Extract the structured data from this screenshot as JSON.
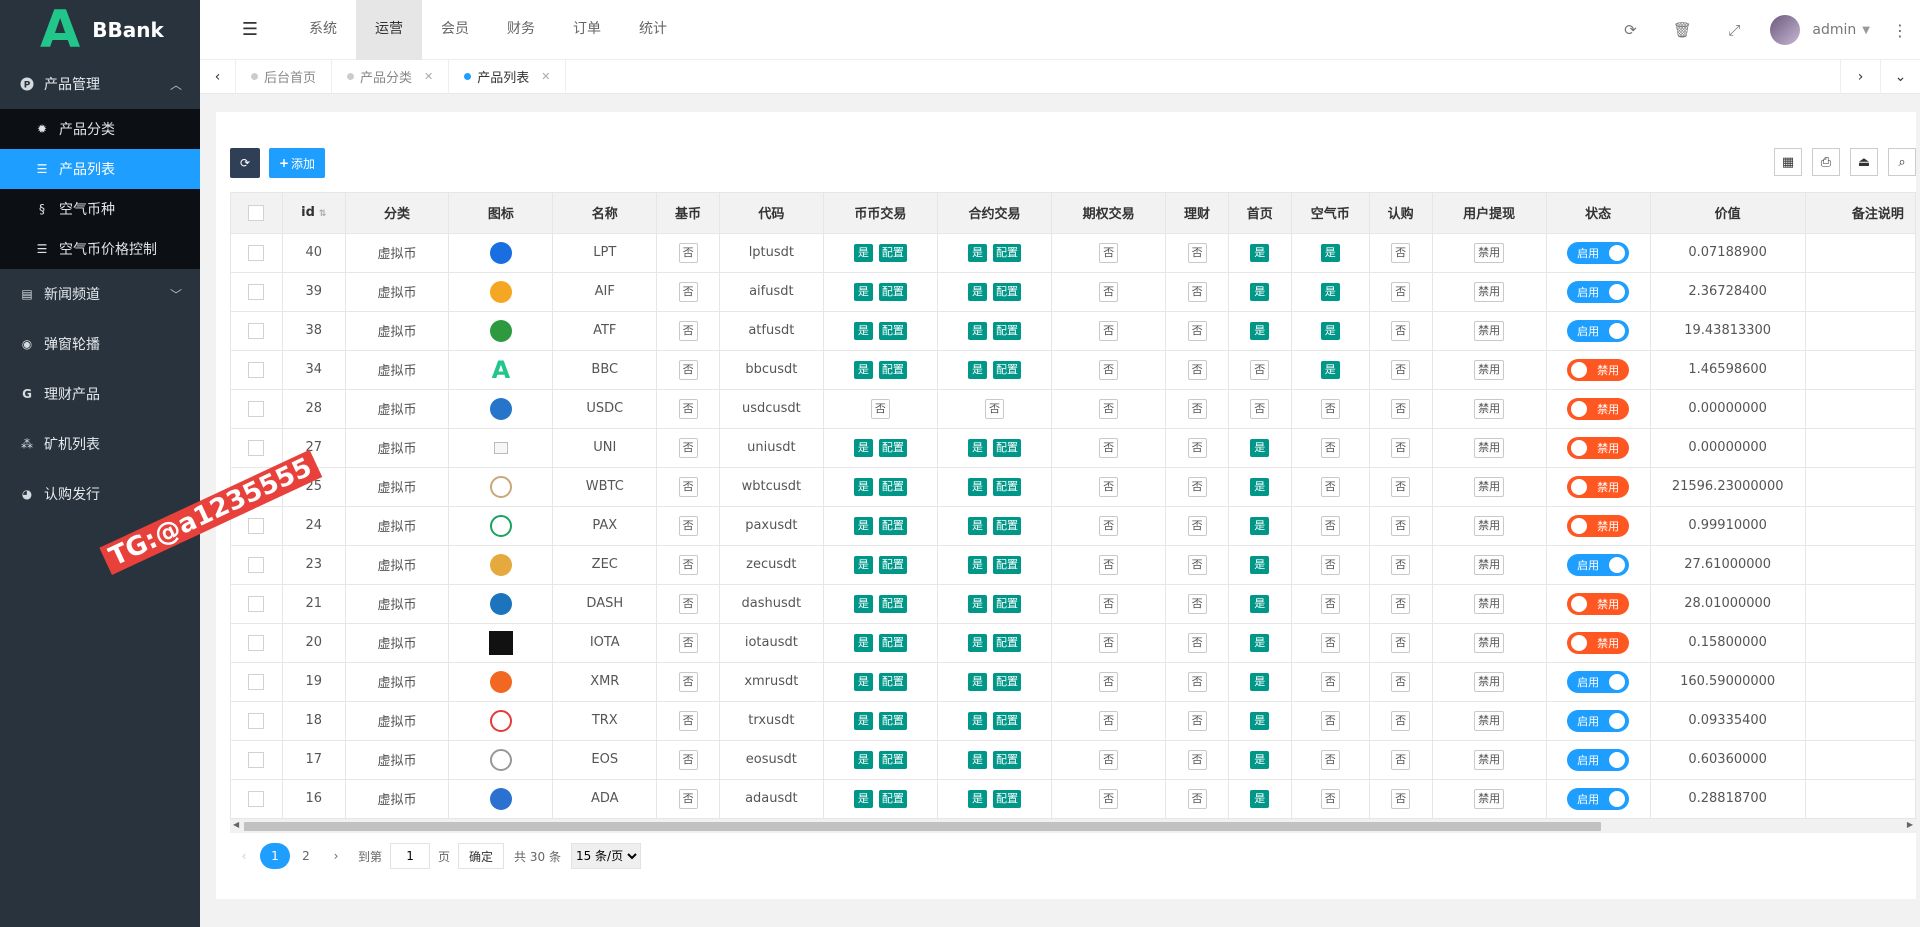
{
  "app": {
    "logo_letter": "A",
    "name": "BBank"
  },
  "sidebar": {
    "groups": [
      {
        "label": "产品管理",
        "icon": "p-circle-icon",
        "expanded": true,
        "items": [
          {
            "label": "产品分类",
            "icon": "gear-icon",
            "active": false
          },
          {
            "label": "产品列表",
            "icon": "list-icon",
            "active": true
          },
          {
            "label": "空气币种",
            "icon": "coin-icon",
            "active": false
          },
          {
            "label": "空气币价格控制",
            "icon": "list-icon",
            "active": false
          }
        ]
      },
      {
        "label": "新闻频道",
        "icon": "news-icon",
        "expanded": false
      },
      {
        "label": "弹窗轮播",
        "icon": "compass-icon"
      },
      {
        "label": "理财产品",
        "icon": "g-icon"
      },
      {
        "label": "矿机列表",
        "icon": "cubes-icon"
      },
      {
        "label": "认购发行",
        "icon": "pie-icon"
      }
    ]
  },
  "header": {
    "nav": [
      "系统",
      "运营",
      "会员",
      "财务",
      "订单",
      "统计"
    ],
    "active_nav": "运营",
    "user": "admin"
  },
  "tabs": [
    {
      "label": "后台首页",
      "closable": false,
      "active": false
    },
    {
      "label": "产品分类",
      "closable": true,
      "active": false
    },
    {
      "label": "产品列表",
      "closable": true,
      "active": true
    }
  ],
  "toolbar": {
    "add_label": "添加"
  },
  "table": {
    "columns": [
      "id",
      "分类",
      "图标",
      "名称",
      "基币",
      "代码",
      "币币交易",
      "合约交易",
      "期权交易",
      "理财",
      "首页",
      "空气币",
      "认购",
      "用户提现",
      "状态",
      "价值",
      "备注说明"
    ],
    "labels": {
      "yes": "是",
      "no": "否",
      "config": "配置",
      "disabled_btn": "禁用",
      "on": "启用",
      "off": "禁用"
    },
    "rows": [
      {
        "id": "40",
        "cat": "虚拟币",
        "icon": "lpt-icon",
        "color": "#1a6fe0",
        "name": "LPT",
        "base": "否",
        "code": "lptusdt",
        "spot": true,
        "contract": true,
        "option": false,
        "finance": false,
        "home": true,
        "air": true,
        "subscribe": false,
        "status": true,
        "value": "0.07188900"
      },
      {
        "id": "39",
        "cat": "虚拟币",
        "icon": "aif-icon",
        "color": "#f5a623",
        "name": "AIF",
        "base": "否",
        "code": "aifusdt",
        "spot": true,
        "contract": true,
        "option": false,
        "finance": false,
        "home": true,
        "air": true,
        "subscribe": false,
        "status": true,
        "value": "2.36728400"
      },
      {
        "id": "38",
        "cat": "虚拟币",
        "icon": "atf-icon",
        "color": "#2e9a3f",
        "name": "ATF",
        "base": "否",
        "code": "atfusdt",
        "spot": true,
        "contract": true,
        "option": false,
        "finance": false,
        "home": true,
        "air": true,
        "subscribe": false,
        "status": true,
        "value": "19.43813300"
      },
      {
        "id": "34",
        "cat": "虚拟币",
        "icon": "bbc-icon",
        "color": "#22c58a",
        "name": "BBC",
        "base": "否",
        "code": "bbcusdt",
        "spot": true,
        "contract": true,
        "option": false,
        "finance": false,
        "home": false,
        "air": true,
        "subscribe": false,
        "status": false,
        "value": "1.46598600"
      },
      {
        "id": "28",
        "cat": "虚拟币",
        "icon": "usdc-icon",
        "color": "#2775ca",
        "name": "USDC",
        "base": "否",
        "code": "usdcusdt",
        "spot": false,
        "contract": false,
        "option": false,
        "finance": false,
        "home": false,
        "air": false,
        "subscribe": false,
        "status": false,
        "value": "0.00000000"
      },
      {
        "id": "27",
        "cat": "虚拟币",
        "icon": "broken-image-icon",
        "color": "#cccccc",
        "name": "UNI",
        "base": "否",
        "code": "uniusdt",
        "spot": true,
        "contract": true,
        "option": false,
        "finance": false,
        "home": true,
        "air": false,
        "subscribe": false,
        "status": false,
        "value": "0.00000000"
      },
      {
        "id": "25",
        "cat": "虚拟币",
        "icon": "wbtc-icon",
        "color": "#c9a87a",
        "name": "WBTC",
        "base": "否",
        "code": "wbtcusdt",
        "spot": true,
        "contract": true,
        "option": false,
        "finance": false,
        "home": true,
        "air": false,
        "subscribe": false,
        "status": false,
        "value": "21596.23000000"
      },
      {
        "id": "24",
        "cat": "虚拟币",
        "icon": "pax-icon",
        "color": "#1aa25e",
        "name": "PAX",
        "base": "否",
        "code": "paxusdt",
        "spot": true,
        "contract": true,
        "option": false,
        "finance": false,
        "home": true,
        "air": false,
        "subscribe": false,
        "status": false,
        "value": "0.99910000"
      },
      {
        "id": "23",
        "cat": "虚拟币",
        "icon": "zec-icon",
        "color": "#e5a93d",
        "name": "ZEC",
        "base": "否",
        "code": "zecusdt",
        "spot": true,
        "contract": true,
        "option": false,
        "finance": false,
        "home": true,
        "air": false,
        "subscribe": false,
        "status": true,
        "value": "27.61000000"
      },
      {
        "id": "21",
        "cat": "虚拟币",
        "icon": "dash-icon",
        "color": "#1c75bc",
        "name": "DASH",
        "base": "否",
        "code": "dashusdt",
        "spot": true,
        "contract": true,
        "option": false,
        "finance": false,
        "home": true,
        "air": false,
        "subscribe": false,
        "status": false,
        "value": "28.01000000"
      },
      {
        "id": "20",
        "cat": "虚拟币",
        "icon": "iota-icon",
        "color": "#111111",
        "name": "IOTA",
        "base": "否",
        "code": "iotausdt",
        "spot": true,
        "contract": true,
        "option": false,
        "finance": false,
        "home": true,
        "air": false,
        "subscribe": false,
        "status": false,
        "value": "0.15800000"
      },
      {
        "id": "19",
        "cat": "虚拟币",
        "icon": "xmr-icon",
        "color": "#f26822",
        "name": "XMR",
        "base": "否",
        "code": "xmrusdt",
        "spot": true,
        "contract": true,
        "option": false,
        "finance": false,
        "home": true,
        "air": false,
        "subscribe": false,
        "status": true,
        "value": "160.59000000"
      },
      {
        "id": "18",
        "cat": "虚拟币",
        "icon": "trx-icon",
        "color": "#e53a3a",
        "name": "TRX",
        "base": "否",
        "code": "trxusdt",
        "spot": true,
        "contract": true,
        "option": false,
        "finance": false,
        "home": true,
        "air": false,
        "subscribe": false,
        "status": true,
        "value": "0.09335400"
      },
      {
        "id": "17",
        "cat": "虚拟币",
        "icon": "eos-icon",
        "color": "#999999",
        "name": "EOS",
        "base": "否",
        "code": "eosusdt",
        "spot": true,
        "contract": true,
        "option": false,
        "finance": false,
        "home": true,
        "air": false,
        "subscribe": false,
        "status": true,
        "value": "0.60360000"
      },
      {
        "id": "16",
        "cat": "虚拟币",
        "icon": "ada-icon",
        "color": "#2a71d0",
        "name": "ADA",
        "base": "否",
        "code": "adausdt",
        "spot": true,
        "contract": true,
        "option": false,
        "finance": false,
        "home": true,
        "air": false,
        "subscribe": false,
        "status": true,
        "value": "0.28818700"
      }
    ]
  },
  "pager": {
    "pages": [
      "1",
      "2"
    ],
    "current": "1",
    "goto_label": "到第",
    "page_input": "1",
    "page_unit": "页",
    "confirm": "确定",
    "total": "共 30 条",
    "size_option": "15 条/页"
  },
  "watermark": "TG:@a1235555"
}
